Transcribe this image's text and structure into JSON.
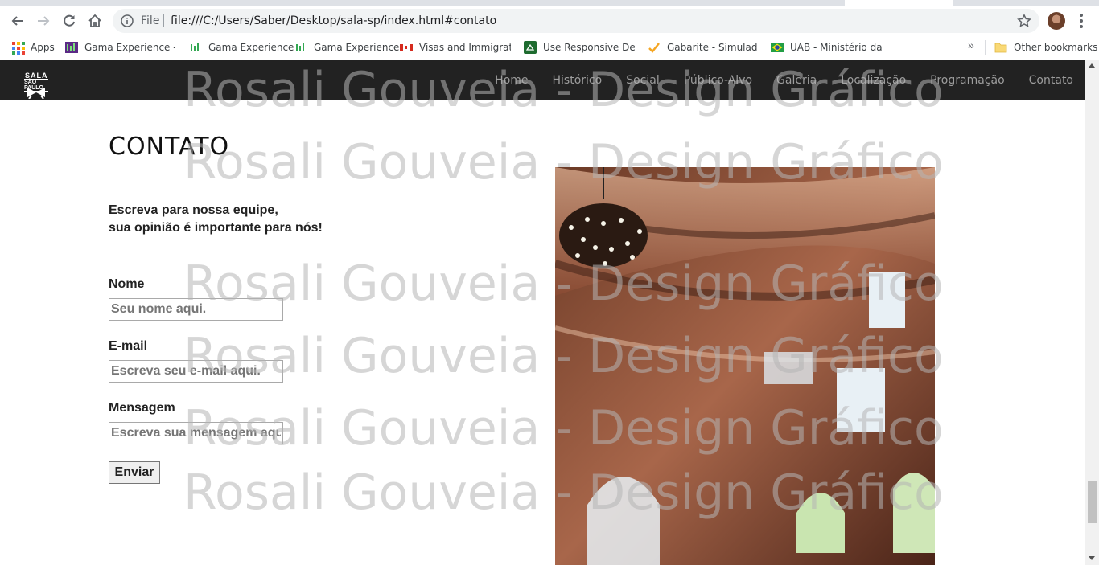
{
  "browser": {
    "scheme_label": "File",
    "url": "file:///C:/Users/Saber/Desktop/sala-sp/index.html#contato",
    "bookmarks": [
      {
        "label": "Apps",
        "icon": "apps-grid-icon"
      },
      {
        "label": "Gama Experience - C",
        "icon": "gama-icon"
      },
      {
        "label": "Gama Experience",
        "icon": "gama-icon"
      },
      {
        "label": "Gama Experience",
        "icon": "gama-icon"
      },
      {
        "label": "Visas and Immigratio",
        "icon": "canada-flag-icon"
      },
      {
        "label": "Use Responsive Desig",
        "icon": "responsive-icon"
      },
      {
        "label": "Gabarite - Simulados",
        "icon": "checkmark-icon"
      },
      {
        "label": "UAB - Ministério da E",
        "icon": "brazil-flag-icon"
      }
    ],
    "overflow_chevron": "»",
    "other_bookmarks": "Other bookmarks"
  },
  "site": {
    "logo_top": "SALA",
    "logo_bottom": "SÃO PAULO",
    "nav": [
      "Home",
      "Histórico",
      "Social",
      "Público-Alvo",
      "Galeria",
      "Localização",
      "Programação",
      "Contato"
    ]
  },
  "contact": {
    "title": "CONTATO",
    "lead_line1": "Escreva para nossa equipe,",
    "lead_line2": "sua opinião é importante para nós!",
    "name_label": "Nome",
    "name_placeholder": "Seu nome aqui.",
    "email_label": "E-mail",
    "email_placeholder": "Escreva seu e-mail aqui.",
    "message_label": "Mensagem",
    "message_placeholder": "Escreva sua mensagem aqui.",
    "submit_label": "Enviar"
  },
  "watermark": {
    "text": "Rosali Gouveia - Design Gráfico"
  },
  "colors": {
    "nav_bg": "#222222",
    "nav_link": "#9d9d9d",
    "watermark": "#b4b4b4"
  }
}
